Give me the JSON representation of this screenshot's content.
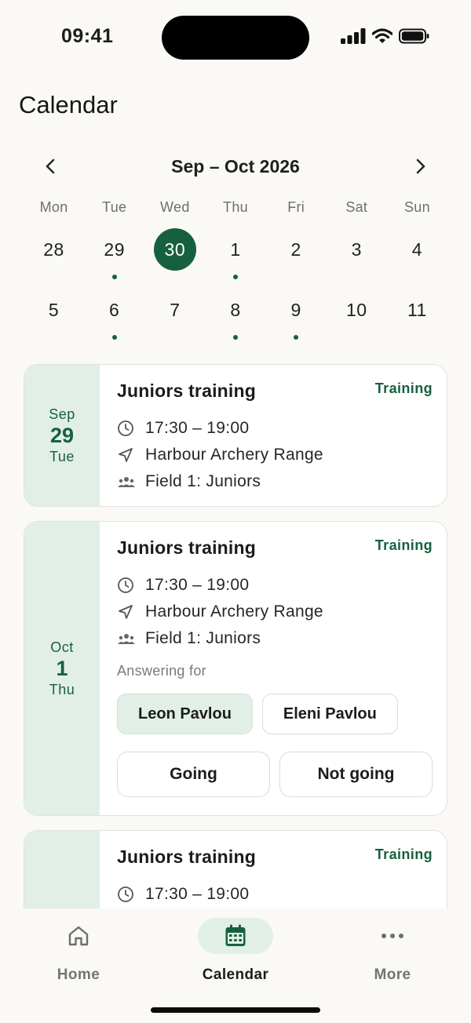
{
  "status_bar": {
    "time": "09:41"
  },
  "page": {
    "title": "Calendar"
  },
  "calendar": {
    "month_label": "Sep – Oct 2026",
    "weekdays": [
      "Mon",
      "Tue",
      "Wed",
      "Thu",
      "Fri",
      "Sat",
      "Sun"
    ],
    "weeks": [
      [
        {
          "day": "28",
          "dot": false,
          "selected": false
        },
        {
          "day": "29",
          "dot": true,
          "selected": false
        },
        {
          "day": "30",
          "dot": false,
          "selected": true
        },
        {
          "day": "1",
          "dot": true,
          "selected": false
        },
        {
          "day": "2",
          "dot": false,
          "selected": false
        },
        {
          "day": "3",
          "dot": false,
          "selected": false
        },
        {
          "day": "4",
          "dot": false,
          "selected": false
        }
      ],
      [
        {
          "day": "5",
          "dot": false,
          "selected": false
        },
        {
          "day": "6",
          "dot": true,
          "selected": false
        },
        {
          "day": "7",
          "dot": false,
          "selected": false
        },
        {
          "day": "8",
          "dot": true,
          "selected": false
        },
        {
          "day": "9",
          "dot": true,
          "selected": false
        },
        {
          "day": "10",
          "dot": false,
          "selected": false
        },
        {
          "day": "11",
          "dot": false,
          "selected": false
        }
      ]
    ]
  },
  "events": [
    {
      "month": "Sep",
      "day": "29",
      "weekday": "Tue",
      "title": "Juniors training",
      "tag": "Training",
      "time": "17:30 – 19:00",
      "location": "Harbour Archery Range",
      "group": "Field 1: Juniors"
    },
    {
      "month": "Oct",
      "day": "1",
      "weekday": "Thu",
      "title": "Juniors training",
      "tag": "Training",
      "time": "17:30 – 19:00",
      "location": "Harbour Archery Range",
      "group": "Field 1: Juniors",
      "answering_for_label": "Answering for",
      "people": [
        "Leon Pavlou",
        "Eleni Pavlou"
      ],
      "rsvp": {
        "going": "Going",
        "not_going": "Not going"
      }
    },
    {
      "title": "Juniors training",
      "tag": "Training",
      "time": "17:30 – 19:00"
    }
  ],
  "tabs": [
    {
      "label": "Home",
      "icon": "home-icon",
      "active": false
    },
    {
      "label": "Calendar",
      "icon": "calendar-icon",
      "active": true
    },
    {
      "label": "More",
      "icon": "more-icon",
      "active": false
    }
  ],
  "colors": {
    "accent": "#17603f",
    "accent_soft": "#e1efe7",
    "background": "#faf9f6"
  }
}
